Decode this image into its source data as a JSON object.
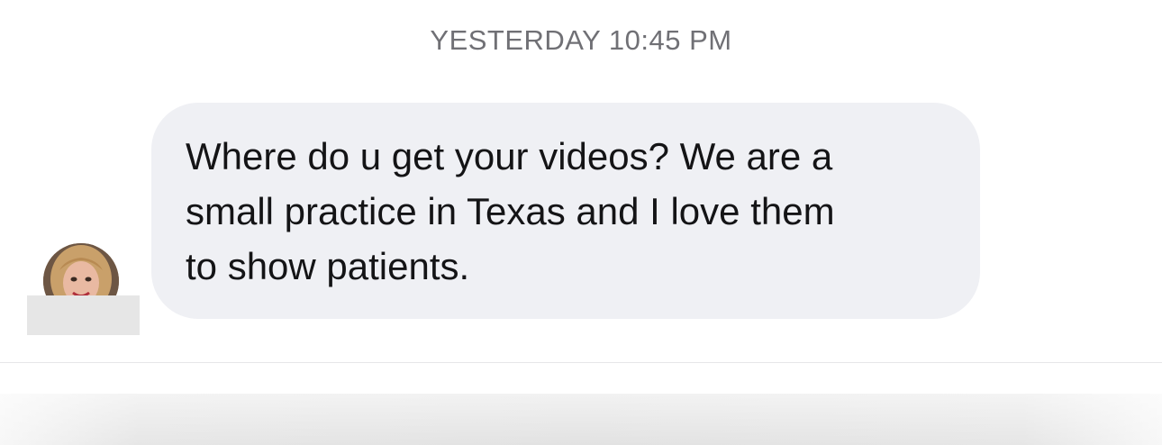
{
  "conversation": {
    "timestamp": "YESTERDAY 10:45 PM",
    "messages": [
      {
        "direction": "incoming",
        "text": "Where do u get your videos?  We are a\nsmall practice in Texas and I love them\nto show patients."
      }
    ]
  },
  "colors": {
    "bubble_incoming": "#eff0f4",
    "timestamp_text": "#707075",
    "message_text": "#141416"
  }
}
